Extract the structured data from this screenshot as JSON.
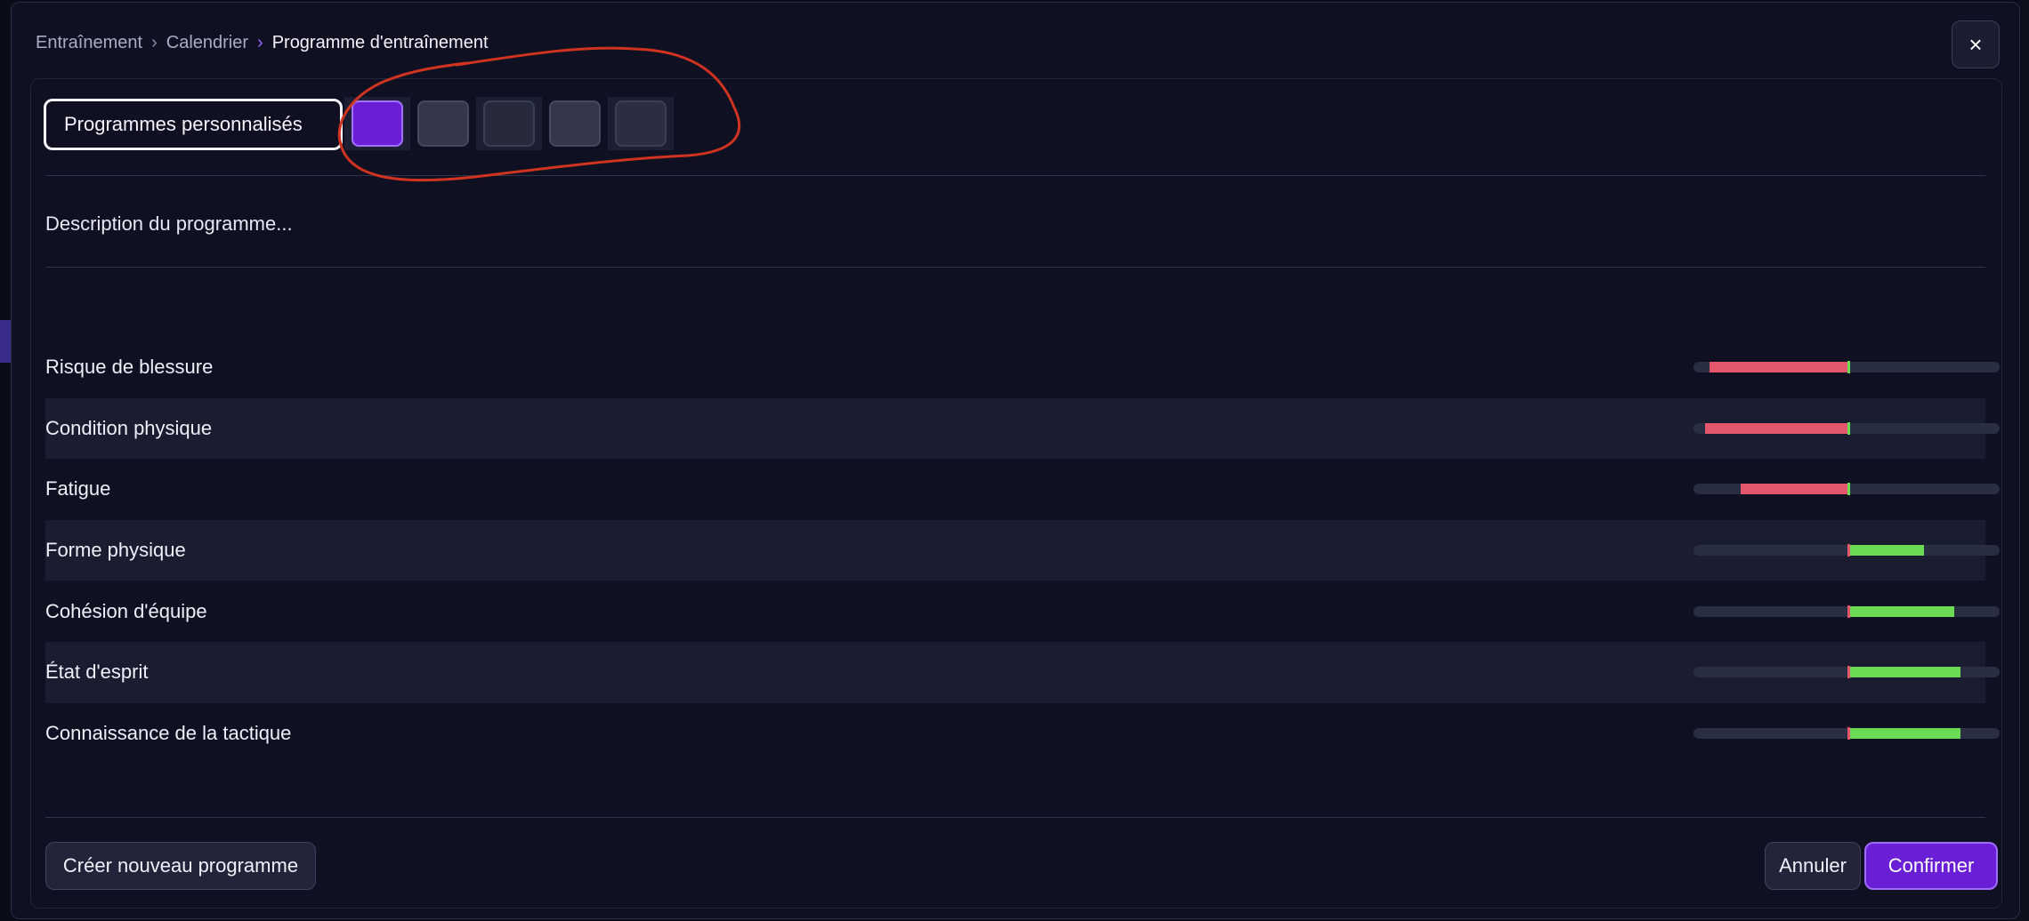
{
  "breadcrumb": {
    "items": [
      "Entraînement",
      "Calendrier",
      "Programme d'entraînement"
    ]
  },
  "close_icon": "×",
  "program_selector": {
    "selected_label": "Programmes personnalisés"
  },
  "swatches": [
    {
      "name": "program-swatch-1",
      "color": "#6a1fd6",
      "border": "#9f73ff",
      "selected": true
    },
    {
      "name": "program-swatch-2",
      "color": "#34374a",
      "border": "#45495f",
      "selected": false
    },
    {
      "name": "program-swatch-3",
      "color": "#262a3b",
      "border": "#3a3e55",
      "selected": false
    },
    {
      "name": "program-swatch-4",
      "color": "#34374a",
      "border": "#45495f",
      "selected": false
    },
    {
      "name": "program-swatch-5",
      "color": "#2a2e40",
      "border": "#3a3e55",
      "selected": false
    }
  ],
  "description": "Description du programme...",
  "stats": [
    {
      "label": "Risque de blessure",
      "value": -0.92,
      "color": "negative"
    },
    {
      "label": "Condition physique",
      "value": -0.95,
      "color": "negative"
    },
    {
      "label": "Fatigue",
      "value": -0.71,
      "color": "negative"
    },
    {
      "label": "Forme physique",
      "value": 0.5,
      "color": "positive"
    },
    {
      "label": "Cohésion d'équipe",
      "value": 0.7,
      "color": "positive"
    },
    {
      "label": "État d'esprit",
      "value": 0.74,
      "color": "positive"
    },
    {
      "label": "Connaissance de la tactique",
      "value": 0.74,
      "color": "positive"
    }
  ],
  "footer": {
    "create_label": "Créer nouveau programme",
    "cancel_label": "Annuler",
    "confirm_label": "Confirmer"
  },
  "colors": {
    "accent": "#6a1fd6",
    "negative": "#e4566c",
    "positive": "#6bdb55",
    "annotation": "#d0331f"
  }
}
